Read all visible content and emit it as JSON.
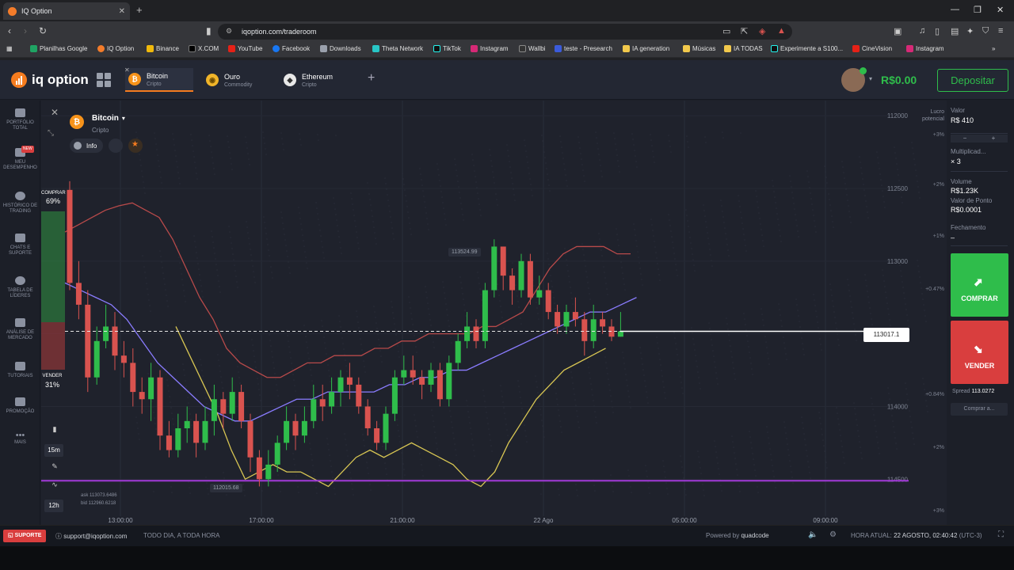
{
  "browser": {
    "tab_title": "IQ Option",
    "url": "iqoption.com/traderoom",
    "bookmarks": [
      "Planilhas Google",
      "IQ Option",
      "Binance",
      "X.COM",
      "YouTube",
      "Facebook",
      "Downloads",
      "Theta Network",
      "TikTok",
      "Instagram",
      "Wallbi",
      "teste - Presearch",
      "IA generation",
      "Músicas",
      "IA TODAS",
      "Experimente a S100...",
      "CineVision",
      "Instagram"
    ]
  },
  "header": {
    "logo": "iq option",
    "assets": [
      {
        "name": "Bitcoin",
        "category": "Cripto",
        "icon": "bitcoin-icon",
        "color": "#f7931a"
      },
      {
        "name": "Ouro",
        "category": "Commodity",
        "icon": "gold-icon",
        "color": "#f0b429"
      },
      {
        "name": "Ethereum",
        "category": "Cripto",
        "icon": "ethereum-icon",
        "color": "#e8e8e8"
      }
    ],
    "balance": "R$0.00",
    "deposit_label": "Depositar"
  },
  "sidebar": {
    "items": [
      {
        "label": "PORTFÓLIO TOTAL"
      },
      {
        "label": "MEU DESEMPENHO",
        "badge": "NEW"
      },
      {
        "label": "HISTÓRICO DE TRADING"
      },
      {
        "label": "CHATS E SUPORTE"
      },
      {
        "label": "TABELA DE LÍDERES"
      },
      {
        "label": "ANÁLISE DE MERCADO"
      },
      {
        "label": "TUTORIAIS"
      },
      {
        "label": "PROMOÇÃO"
      },
      {
        "label": "MAIS"
      }
    ]
  },
  "chart": {
    "asset": "Bitcoin",
    "category": "Cripto",
    "info_label": "Info",
    "buy_label": "COMPRAR",
    "buy_pct": "69%",
    "sell_label": "VENDER",
    "sell_pct": "31%",
    "current_price": "113017.1",
    "high_label": "113524.99",
    "low_label": "112015.68",
    "ask": "ask 113073.6486",
    "bid": "bid 112960.6218",
    "timeframe": "15m",
    "period": "12h",
    "y_ticks": [
      "114500",
      "114000",
      "113500",
      "113000",
      "112500",
      "112000"
    ],
    "pct_ticks": [
      "+3%",
      "+2%",
      "+1%",
      "+0.47%",
      "+0.84%",
      "+2%",
      "+3%"
    ],
    "x_ticks": [
      "13:00:00",
      "17:00:00",
      "21:00:00",
      "22 Ago",
      "05:00:00",
      "09:00:00"
    ],
    "lucro_label": "Lucro potencial"
  },
  "chart_data": {
    "type": "candlestick",
    "x_ticks": [
      "13:00:00",
      "17:00:00",
      "21:00:00",
      "22 Ago",
      "05:00:00",
      "09:00:00"
    ],
    "y_ticks": [
      112000,
      112500,
      113000,
      113500,
      114000,
      114500
    ],
    "ylim": [
      111800,
      114550
    ],
    "current_price": 113017.1,
    "candles": [
      [
        113990,
        113350,
        114050,
        113300
      ],
      [
        113350,
        113200,
        113500,
        113100
      ],
      [
        113200,
        112700,
        113300,
        112600
      ],
      [
        112700,
        112950,
        113050,
        112650
      ],
      [
        112950,
        113050,
        113200,
        112900
      ],
      [
        113050,
        112850,
        113150,
        112750
      ],
      [
        112850,
        112800,
        112950,
        112700
      ],
      [
        112800,
        112600,
        112900,
        112500
      ],
      [
        112600,
        112550,
        112700,
        112450
      ],
      [
        112550,
        112700,
        112800,
        112400
      ],
      [
        112700,
        112300,
        112750,
        112200
      ],
      [
        112300,
        112200,
        112400,
        112150
      ],
      [
        112200,
        112350,
        112450,
        112150
      ],
      [
        112350,
        112400,
        112500,
        112250
      ],
      [
        112400,
        112250,
        112450,
        112150
      ],
      [
        112250,
        112400,
        112500,
        112200
      ],
      [
        112400,
        112550,
        112650,
        112300
      ],
      [
        112550,
        112450,
        112600,
        112350
      ],
      [
        112450,
        112600,
        112700,
        112400
      ],
      [
        112600,
        112400,
        112650,
        112350
      ],
      [
        112400,
        112150,
        112450,
        112050
      ],
      [
        112150,
        112000,
        112200,
        111950
      ],
      [
        112000,
        112100,
        112200,
        111950
      ],
      [
        112100,
        112250,
        112300,
        112050
      ],
      [
        112250,
        112400,
        112500,
        112200
      ],
      [
        112400,
        112300,
        112450,
        112200
      ],
      [
        112300,
        112400,
        112500,
        112250
      ],
      [
        112400,
        112550,
        112650,
        112350
      ],
      [
        112550,
        112500,
        112650,
        112400
      ],
      [
        112500,
        112600,
        112700,
        112450
      ],
      [
        112600,
        112700,
        112750,
        112500
      ],
      [
        112700,
        112650,
        112800,
        112550
      ],
      [
        112650,
        112500,
        112700,
        112450
      ],
      [
        112500,
        112350,
        112550,
        112300
      ],
      [
        112350,
        112250,
        112400,
        112200
      ],
      [
        112250,
        112450,
        112500,
        112200
      ],
      [
        112450,
        112700,
        112750,
        112400
      ],
      [
        112700,
        112750,
        112850,
        112650
      ],
      [
        112750,
        112700,
        112850,
        112650
      ],
      [
        112700,
        112650,
        112750,
        112550
      ],
      [
        112650,
        112750,
        112800,
        112600
      ],
      [
        112750,
        112550,
        112800,
        112500
      ],
      [
        112550,
        112800,
        112850,
        112500
      ],
      [
        112800,
        112950,
        113000,
        112750
      ],
      [
        112950,
        113050,
        113150,
        112900
      ],
      [
        113050,
        112950,
        113100,
        112900
      ],
      [
        112950,
        113300,
        113350,
        112900
      ],
      [
        113300,
        113600,
        113650,
        113250
      ],
      [
        113600,
        113400,
        113600,
        113300
      ],
      [
        113400,
        113300,
        113450,
        113200
      ],
      [
        113300,
        113500,
        113550,
        113250
      ],
      [
        113500,
        113250,
        113550,
        113200
      ],
      [
        113250,
        113300,
        113400,
        113200
      ],
      [
        113300,
        113150,
        113350,
        113100
      ],
      [
        113150,
        113050,
        113200,
        113000
      ],
      [
        113050,
        113150,
        113200,
        113000
      ],
      [
        113150,
        113100,
        113250,
        113050
      ],
      [
        113100,
        112950,
        113150,
        112850
      ],
      [
        112950,
        113100,
        113200,
        112900
      ],
      [
        113100,
        113050,
        113150,
        113000
      ],
      [
        113050,
        112980,
        113100,
        112950
      ],
      [
        112980,
        113017,
        113150,
        112980
      ]
    ],
    "series": [
      {
        "name": "upper_band",
        "color": "#d9534f"
      },
      {
        "name": "middle_line",
        "color": "#8a7cff"
      },
      {
        "name": "lower_band",
        "color": "#e6d35a"
      }
    ],
    "upper_band": [
      113700,
      113750,
      113800,
      113850,
      113880,
      113900,
      113850,
      113800,
      113650,
      113450,
      113250,
      113100,
      112900,
      112800,
      112750,
      112700,
      112700,
      112750,
      112800,
      112800,
      112850,
      112850,
      112850,
      112900,
      112900,
      112950,
      112950,
      113000,
      113000,
      113000,
      113000,
      113050,
      113050,
      113100,
      113150,
      113300,
      113450,
      113550,
      113600,
      113600,
      113600,
      113550,
      113550
    ],
    "middle_line": [
      113350,
      113300,
      113250,
      113200,
      113100,
      112950,
      112800,
      112700,
      112600,
      112500,
      112450,
      112400,
      112400,
      112450,
      112500,
      112550,
      112550,
      112600,
      112600,
      112600,
      112600,
      112650,
      112650,
      112700,
      112700,
      112750,
      112750,
      112800,
      112850,
      112900,
      112950,
      113000,
      113050,
      113100,
      113150,
      113150,
      113200,
      113250
    ],
    "lower_band": [
      113050,
      112850,
      112650,
      112450,
      112200,
      112000,
      112050,
      112100,
      112050,
      112050,
      112000,
      111950,
      112050,
      112150,
      112200,
      112150,
      112200,
      112250,
      112200,
      112150,
      112100,
      112000,
      111950,
      112050,
      112250,
      112400,
      112550,
      112650,
      112750,
      112800,
      112850,
      112900
    ],
    "horizontal_line": 112000
  },
  "panel": {
    "valor_label": "Valor",
    "valor": "R$ 410",
    "mult_label": "Multiplicad...",
    "mult": "× 3",
    "volume_label": "Volume",
    "volume": "R$1.23K",
    "ponto_label": "Valor de Ponto",
    "ponto": "R$0.0001",
    "fech_label": "Fechamento",
    "fech": "–",
    "buy": "COMPRAR",
    "sell": "VENDER",
    "spread_label": "Spread",
    "spread": "113.0272",
    "comprar_a": "Comprar a..."
  },
  "footer": {
    "support": "SUPORTE",
    "email": "support@iqoption.com",
    "hours": "TODO DIA, A TODA HORA",
    "powered": "Powered by",
    "brand": "quadcode",
    "time_label": "HORA ATUAL:",
    "time": "22 AGOSTO, 02:40:42",
    "tz": "(UTC-3)"
  }
}
